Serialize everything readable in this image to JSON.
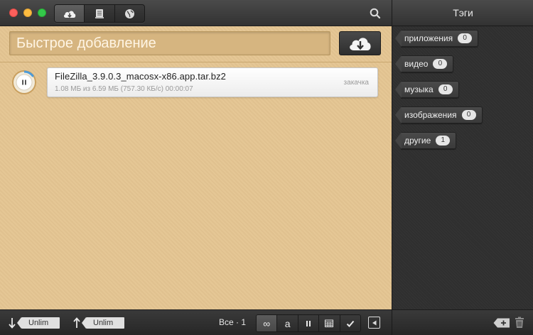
{
  "main": {
    "quick_add_placeholder": "Быстрое добавление"
  },
  "downloads": [
    {
      "name": "FileZilla_3.9.0.3_macosx-x86.app.tar.bz2",
      "meta": "1.08 МБ из 6.59 МБ  (757.30 КБ/с) 00:00:07",
      "status": "закачка",
      "progress": 0.16
    }
  ],
  "bottombar": {
    "down_limit": "Unlim",
    "up_limit": "Unlim",
    "count": "Все · 1",
    "filter_infinity": "∞",
    "filter_a": "a"
  },
  "sidebar": {
    "title": "Тэги",
    "tags": [
      {
        "label": "приложения",
        "count": "0"
      },
      {
        "label": "видео",
        "count": "0"
      },
      {
        "label": "музыка",
        "count": "0"
      },
      {
        "label": "изображения",
        "count": "0"
      },
      {
        "label": "другие",
        "count": "1"
      }
    ]
  },
  "colors": {
    "main_bg": "#e4c592",
    "sidebar_bg": "#2f2f2f",
    "accent_ring": "#4d9bd8"
  }
}
